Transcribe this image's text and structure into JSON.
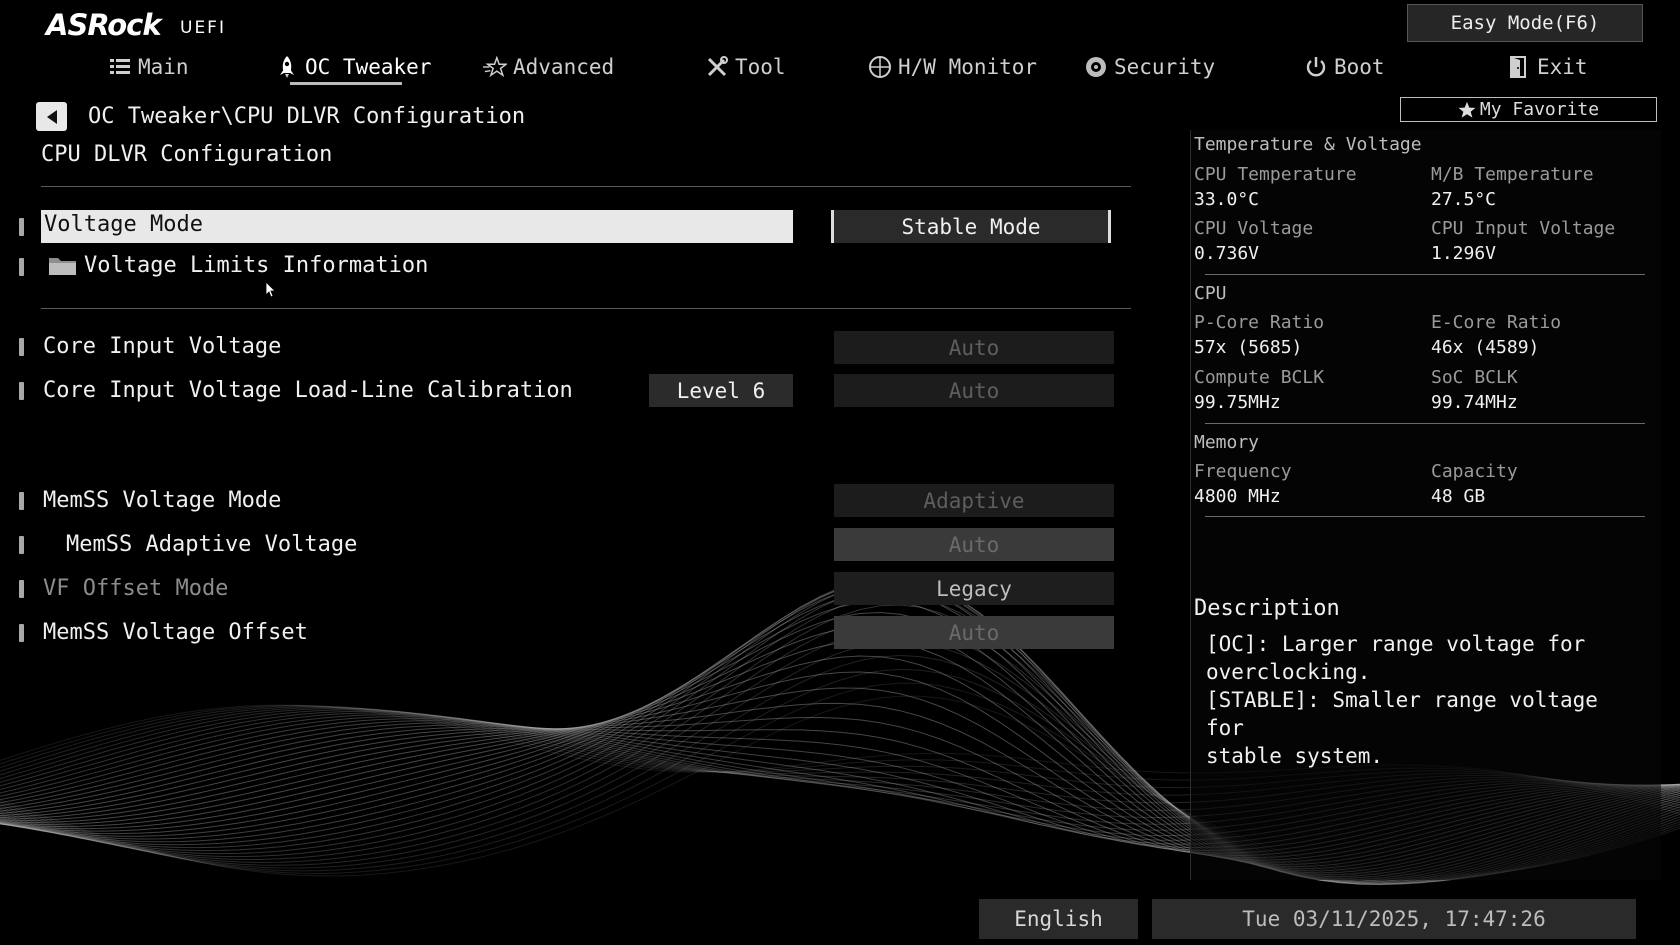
{
  "logo": {
    "brand": "ASRock",
    "sub": "UEFI"
  },
  "easy_mode_label": "Easy Mode(F6)",
  "tabs": [
    {
      "label": "Main",
      "icon": "list-icon"
    },
    {
      "label": "OC Tweaker",
      "icon": "rocket-icon",
      "active": true
    },
    {
      "label": "Advanced",
      "icon": "star-icon"
    },
    {
      "label": "Tool",
      "icon": "tools-icon"
    },
    {
      "label": "H/W Monitor",
      "icon": "monitor-icon"
    },
    {
      "label": "Security",
      "icon": "shield-icon"
    },
    {
      "label": "Boot",
      "icon": "power-icon"
    },
    {
      "label": "Exit",
      "icon": "exit-icon"
    }
  ],
  "breadcrumb": "OC Tweaker\\CPU DLVR Configuration",
  "page_title": "CPU DLVR Configuration",
  "settings": {
    "voltage_mode": {
      "label": "Voltage Mode",
      "value": "Stable Mode"
    },
    "voltage_limits": {
      "label": "Voltage Limits Information"
    },
    "core_input_voltage": {
      "label": "Core Input Voltage",
      "value": "Auto"
    },
    "core_input_llc": {
      "label": "Core Input Voltage Load-Line Calibration",
      "current": "Level 6",
      "value": "Auto"
    },
    "memss_voltage_mode": {
      "label": "MemSS Voltage Mode",
      "value": "Adaptive"
    },
    "memss_adaptive_voltage": {
      "label": "MemSS Adaptive Voltage",
      "value": "Auto"
    },
    "vf_offset_mode": {
      "label": "VF Offset Mode",
      "value": "Legacy"
    },
    "memss_voltage_offset": {
      "label": "MemSS Voltage Offset",
      "value": "Auto"
    }
  },
  "my_favorite": "My Favorite",
  "hw": {
    "temp_voltage": {
      "title": "Temperature & Voltage",
      "cpu_temp_label": "CPU Temperature",
      "cpu_temp": "33.0°C",
      "mb_temp_label": "M/B Temperature",
      "mb_temp": "27.5°C",
      "cpu_voltage_label": "CPU Voltage",
      "cpu_voltage": "0.736V",
      "cpu_input_voltage_label": "CPU Input Voltage",
      "cpu_input_voltage": "1.296V"
    },
    "cpu": {
      "title": "CPU",
      "pcore_label": "P-Core Ratio",
      "pcore": "57x (5685)",
      "ecore_label": "E-Core Ratio",
      "ecore": "46x (4589)",
      "compute_bclk_label": "Compute BCLK",
      "compute_bclk": "99.75MHz",
      "soc_bclk_label": "SoC BCLK",
      "soc_bclk": "99.74MHz"
    },
    "memory": {
      "title": "Memory",
      "freq_label": "Frequency",
      "freq": "4800 MHz",
      "capacity_label": "Capacity",
      "capacity": "48 GB"
    }
  },
  "description": {
    "title": "Description",
    "text": "[OC]: Larger range voltage for\noverclocking.\n[STABLE]: Smaller range voltage for\nstable system."
  },
  "footer": {
    "language": "English",
    "datetime": "Tue 03/11/2025, 17:47:26"
  }
}
